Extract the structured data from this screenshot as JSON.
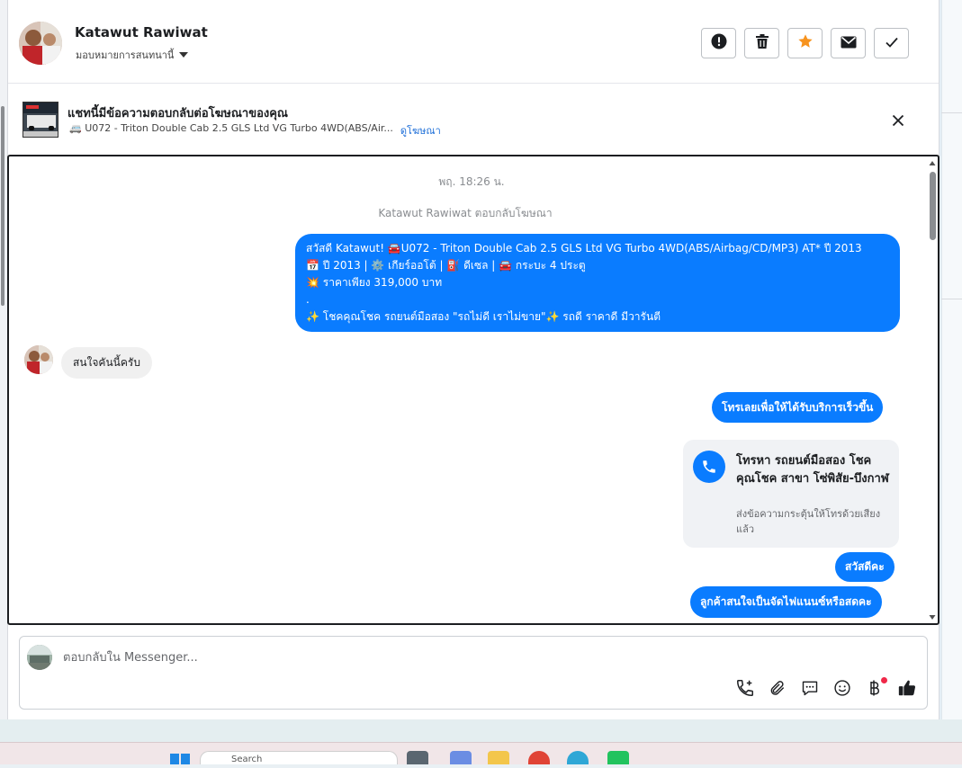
{
  "header": {
    "contact_name": "Katawut Rawiwat",
    "assign_label": "มอบหมายการสนทนานี้",
    "buttons": [
      {
        "icon": "exclamation-circle-icon"
      },
      {
        "icon": "trash-icon"
      },
      {
        "icon": "star-icon"
      },
      {
        "icon": "envelope-icon"
      },
      {
        "icon": "checkmark-icon"
      }
    ]
  },
  "ad_banner": {
    "title": "แชทนี้มีข้อความตอบกลับต่อโฆษณาของคุณ",
    "subtitle": "🚐 U072 - Triton Double Cab 2.5 GLS Ltd VG Turbo 4WD(ABS/Air...",
    "link": "ดูโฆษณา"
  },
  "conversation": {
    "date": "พฤ. 18:26 น.",
    "system_note": "Katawut Rawiwat ตอบกลับโฆษณา",
    "main_message": [
      "สวัสดี Katawut! 🚘U072 - Triton Double Cab 2.5 GLS Ltd VG Turbo 4WD(ABS/Airbag/CD/MP3) AT* ปี 2013",
      "📅 ปี 2013 | ⚙️ เกียร์ออโต้ | ⛽ ดีเซล | 🚘 กระบะ 4 ประตู",
      "💥 ราคาเพียง 319,000 บาท",
      ".",
      "✨ โชคคุณโชค รถยนต์มือสอง \"รถไม่ดี เราไม่ขาย\"✨ รถดี ราคาดี มีวารันตี"
    ],
    "incoming_message": "สนใจคันนี้ครับ",
    "call_prompt": "โทรเลยเพื่อให้ได้รับบริการเร็วขึ้น",
    "call_card": {
      "title": "โทรหา รถยนต์มือสอง โชคคุณโชค สาขา โซ่พิสัย-บึงกาฬ",
      "subtitle": "ส่งข้อความกระตุ้นให้โทรด้วยเสียงแล้ว"
    },
    "greeting": "สวัสดีคะ",
    "question": "ลูกค้าสนใจเป็นจัดไฟแนนซ์หรือสดคะ"
  },
  "composer": {
    "placeholder": "ตอบกลับใน Messenger...",
    "tools": [
      "call-add-icon",
      "paperclip-icon",
      "quick-reply-icon",
      "emoji-icon",
      "baht-icon",
      "thumbs-up-icon"
    ]
  },
  "taskbar": {
    "search_placeholder": "Search"
  }
}
